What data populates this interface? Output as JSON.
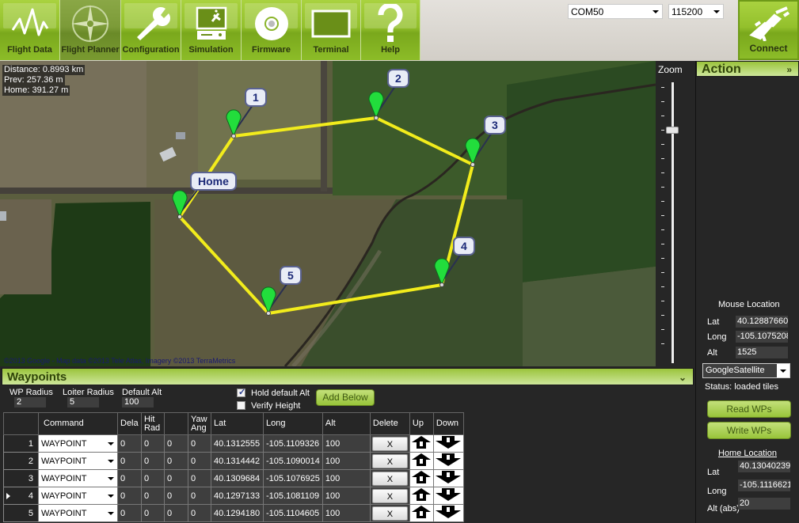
{
  "toolbar": {
    "buttons": [
      {
        "id": "flight-data",
        "label": "Flight Data",
        "icon": "pulse-icon",
        "active": false
      },
      {
        "id": "flight-planner",
        "label": "Flight Planner",
        "icon": "compass-icon",
        "active": true
      },
      {
        "id": "configuration",
        "label": "Configuration",
        "icon": "wrench-icon",
        "active": false
      },
      {
        "id": "simulation",
        "label": "Simulation",
        "icon": "computer-plane-icon",
        "active": false
      },
      {
        "id": "firmware",
        "label": "Firmware",
        "icon": "disc-icon",
        "active": false
      },
      {
        "id": "terminal",
        "label": "Terminal",
        "icon": "monitor-icon",
        "active": false
      },
      {
        "id": "help",
        "label": "Help",
        "icon": "question-icon",
        "active": false
      }
    ],
    "port": "COM50",
    "baud": "115200",
    "connect_label": "Connect"
  },
  "map": {
    "info": {
      "distance": "Distance: 0.8993 km",
      "prev": "Prev: 257.36 m",
      "home": "Home: 391.27 m"
    },
    "copyright": "©2013 Google - Map data ©2013 Tele Atlas, Imagery ©2013 TerraMetrics",
    "markers": [
      {
        "label": "Home"
      },
      {
        "label": "1"
      },
      {
        "label": "2"
      },
      {
        "label": "3"
      },
      {
        "label": "4"
      },
      {
        "label": "5"
      }
    ],
    "path_color": "#f2ec1c",
    "marker_color": "#22dd3c"
  },
  "zoom": {
    "label": "Zoom",
    "level_fraction": 0.16
  },
  "action": {
    "title": "Action",
    "collapse_glyph": "»",
    "mouse_location": {
      "title": "Mouse Location",
      "lat_label": "Lat",
      "lat": "40.12887660!",
      "long_label": "Long",
      "long": "-105.1075208",
      "alt_label": "Alt",
      "alt": "1525"
    },
    "map_type": "GoogleSatellite",
    "status": "Status: loaded tiles",
    "read_wps": "Read WPs",
    "write_wps": "Write WPs",
    "home_location": {
      "title": "Home Location",
      "lat_label": "Lat",
      "lat": "40.13040239:",
      "long_label": "Long",
      "long": "-105.1116621",
      "alt_label": "Alt (abs)",
      "alt": "20"
    }
  },
  "waypoints": {
    "title": "Waypoints",
    "collapse_glyph": "¥",
    "wp_radius_label": "WP Radius",
    "wp_radius": "2",
    "loiter_radius_label": "Loiter Radius",
    "loiter_radius": "5",
    "default_alt_label": "Default Alt",
    "default_alt": "100",
    "hold_default_alt_label": "Hold default Alt",
    "hold_default_alt": true,
    "verify_height_label": "Verify Height",
    "verify_height": false,
    "add_below_label": "Add Below",
    "columns": [
      "",
      "Command",
      "Dela",
      "Hit Rad",
      "",
      "Yaw Ang",
      "Lat",
      "Long",
      "Alt",
      "Delete",
      "Up",
      "Down"
    ],
    "selected_row": 4,
    "rows": [
      {
        "n": "1",
        "command": "WAYPOINT",
        "p1": "0",
        "p2": "0",
        "p3": "0",
        "p4": "0",
        "lat": "40.1312555",
        "long": "-105.1109326",
        "alt": "100"
      },
      {
        "n": "2",
        "command": "WAYPOINT",
        "p1": "0",
        "p2": "0",
        "p3": "0",
        "p4": "0",
        "lat": "40.1314442",
        "long": "-105.1090014",
        "alt": "100"
      },
      {
        "n": "3",
        "command": "WAYPOINT",
        "p1": "0",
        "p2": "0",
        "p3": "0",
        "p4": "0",
        "lat": "40.1309684",
        "long": "-105.1076925",
        "alt": "100"
      },
      {
        "n": "4",
        "command": "WAYPOINT",
        "p1": "0",
        "p2": "0",
        "p3": "0",
        "p4": "0",
        "lat": "40.1297133",
        "long": "-105.1081109",
        "alt": "100"
      },
      {
        "n": "5",
        "command": "WAYPOINT",
        "p1": "0",
        "p2": "0",
        "p3": "0",
        "p4": "0",
        "lat": "40.1294180",
        "long": "-105.1104605",
        "alt": "100"
      }
    ],
    "delete_label": "X"
  }
}
